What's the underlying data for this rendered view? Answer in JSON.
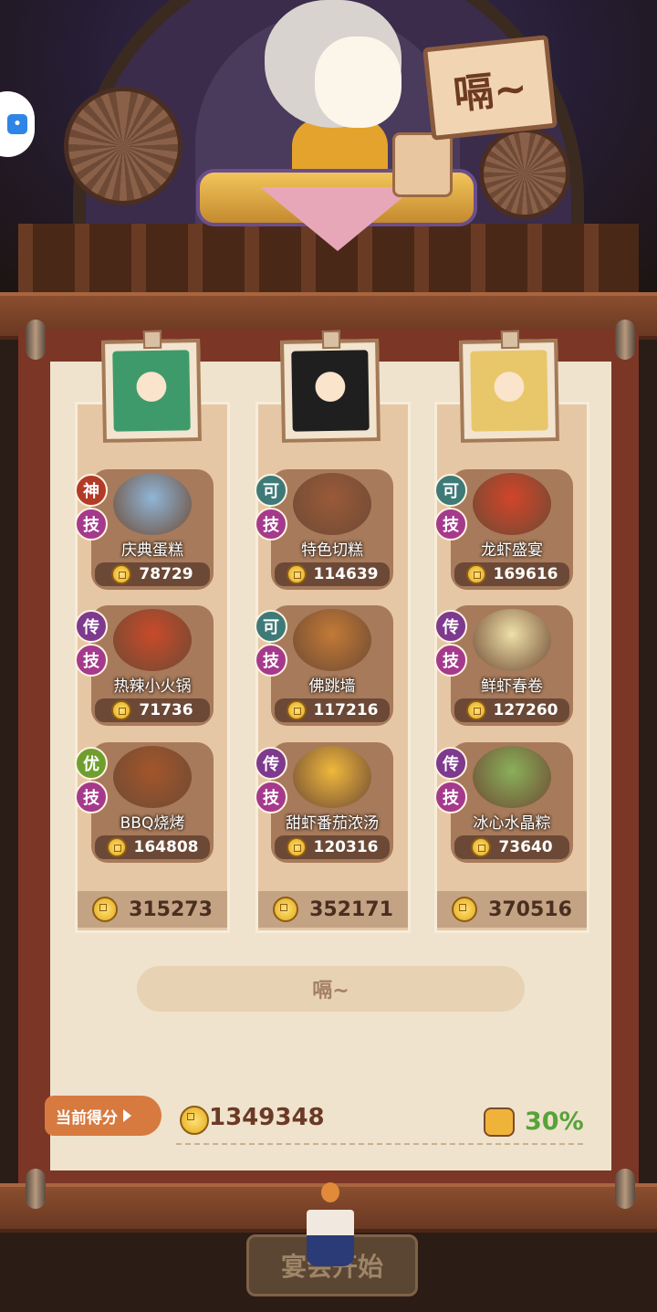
{
  "header": {
    "sign_text": "嗝~"
  },
  "columns": [
    {
      "avatar_color": "#3e9a6a",
      "dishes": [
        {
          "name": "庆典蛋糕",
          "score": "78729",
          "rank_badge": "神",
          "rank_color": "#b33a27",
          "skill_badge": "技",
          "image_color": "#8fb6d8"
        },
        {
          "name": "热辣小火锅",
          "score": "71736",
          "rank_badge": "传",
          "rank_color": "#7e3a8e",
          "skill_badge": "技",
          "image_color": "#c94a2a"
        },
        {
          "name": "BBQ烧烤",
          "score": "164808",
          "rank_badge": "优",
          "rank_color": "#6f9e2e",
          "skill_badge": "技",
          "image_color": "#a3562b"
        }
      ],
      "total": "315273"
    },
    {
      "avatar_color": "#1f1f1f",
      "dishes": [
        {
          "name": "特色切糕",
          "score": "114639",
          "rank_badge": "可",
          "rank_color": "#3d7a78",
          "skill_badge": "技",
          "image_color": "#9a5a3a"
        },
        {
          "name": "佛跳墙",
          "score": "117216",
          "rank_badge": "可",
          "rank_color": "#3d7a78",
          "skill_badge": "技",
          "image_color": "#c27a36"
        },
        {
          "name": "甜虾番茄浓汤",
          "score": "120316",
          "rank_badge": "传",
          "rank_color": "#7e3a8e",
          "skill_badge": "技",
          "image_color": "#f0b83c"
        }
      ],
      "total": "352171"
    },
    {
      "avatar_color": "#e8c76a",
      "dishes": [
        {
          "name": "龙虾盛宴",
          "score": "169616",
          "rank_badge": "可",
          "rank_color": "#3d7a78",
          "skill_badge": "技",
          "image_color": "#d2452a"
        },
        {
          "name": "鲜虾春卷",
          "score": "127260",
          "rank_badge": "传",
          "rank_color": "#7e3a8e",
          "skill_badge": "技",
          "image_color": "#efe0a8"
        },
        {
          "name": "冰心水晶粽",
          "score": "73640",
          "rank_badge": "传",
          "rank_color": "#7e3a8e",
          "skill_badge": "技",
          "image_color": "#8ab05a"
        }
      ],
      "total": "370516"
    }
  ],
  "action_button": {
    "label": "嗝~"
  },
  "score_panel": {
    "label": "当前得分",
    "total": "1349348",
    "bonus": "30%"
  },
  "start_button": {
    "label": "宴会开始"
  }
}
